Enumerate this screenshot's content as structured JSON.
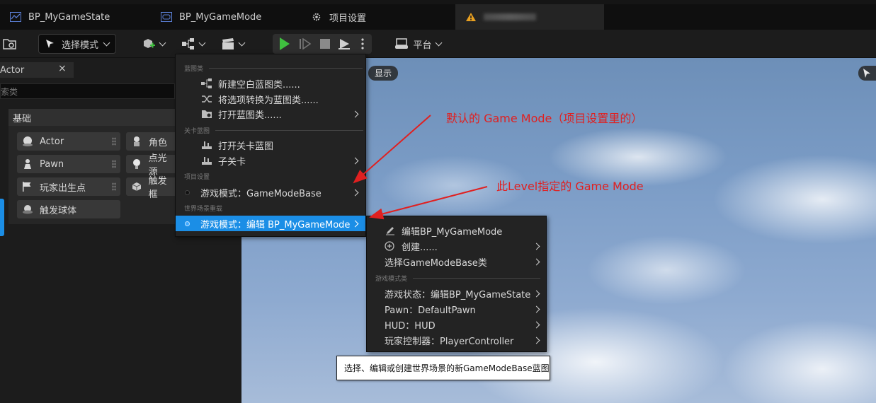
{
  "tabs": [
    {
      "label": "BP_MyGameState"
    },
    {
      "label": "BP_MyGameMode"
    },
    {
      "label": "项目设置"
    }
  ],
  "toolbar": {
    "mode_label": "选择模式",
    "platform_label": "平台"
  },
  "left_panel": {
    "tab_label": "Actor",
    "close_symbol": "×",
    "search_text": "索类",
    "section_title": "基础",
    "items": [
      {
        "label": "Actor"
      },
      {
        "label": "角色"
      },
      {
        "label": "Pawn"
      },
      {
        "label": "点光源"
      },
      {
        "label": "玩家出生点"
      },
      {
        "label": "触发框"
      },
      {
        "label": "触发球体"
      }
    ]
  },
  "viewport": {
    "view_button": "显示"
  },
  "menu": {
    "sections": [
      {
        "title": "蓝图类"
      },
      {
        "title": "关卡蓝图"
      },
      {
        "title": "项目设置"
      },
      {
        "title": "世界场景重载"
      }
    ],
    "items": [
      {
        "label": "新建空白蓝图类......"
      },
      {
        "label": "将选项转换为蓝图类......"
      },
      {
        "label": "打开蓝图类......"
      },
      {
        "label": "打开关卡蓝图"
      },
      {
        "label": "子关卡"
      },
      {
        "label": "游戏模式：GameModeBase"
      },
      {
        "label": "游戏模式：编辑 BP_MyGameMode"
      }
    ],
    "highlight_color": "#1b8ee6"
  },
  "submenu": {
    "section_title": "游戏模式类",
    "items": [
      {
        "label": "编辑BP_MyGameMode"
      },
      {
        "label": "创建......"
      },
      {
        "label": "选择GameModeBase类"
      },
      {
        "label": "游戏状态：编辑BP_MyGameState"
      },
      {
        "label": "Pawn：DefaultPawn"
      },
      {
        "label": "HUD：HUD"
      },
      {
        "label": "玩家控制器：PlayerController"
      }
    ]
  },
  "tooltip": {
    "text": "选择、编辑或创建世界场景的新GameModeBase蓝图"
  },
  "annotations": [
    {
      "text": "默认的 Game Mode（项目设置里的）"
    },
    {
      "text": "此Level指定的 Game Mode"
    }
  ],
  "annotation_color": "#e02020"
}
